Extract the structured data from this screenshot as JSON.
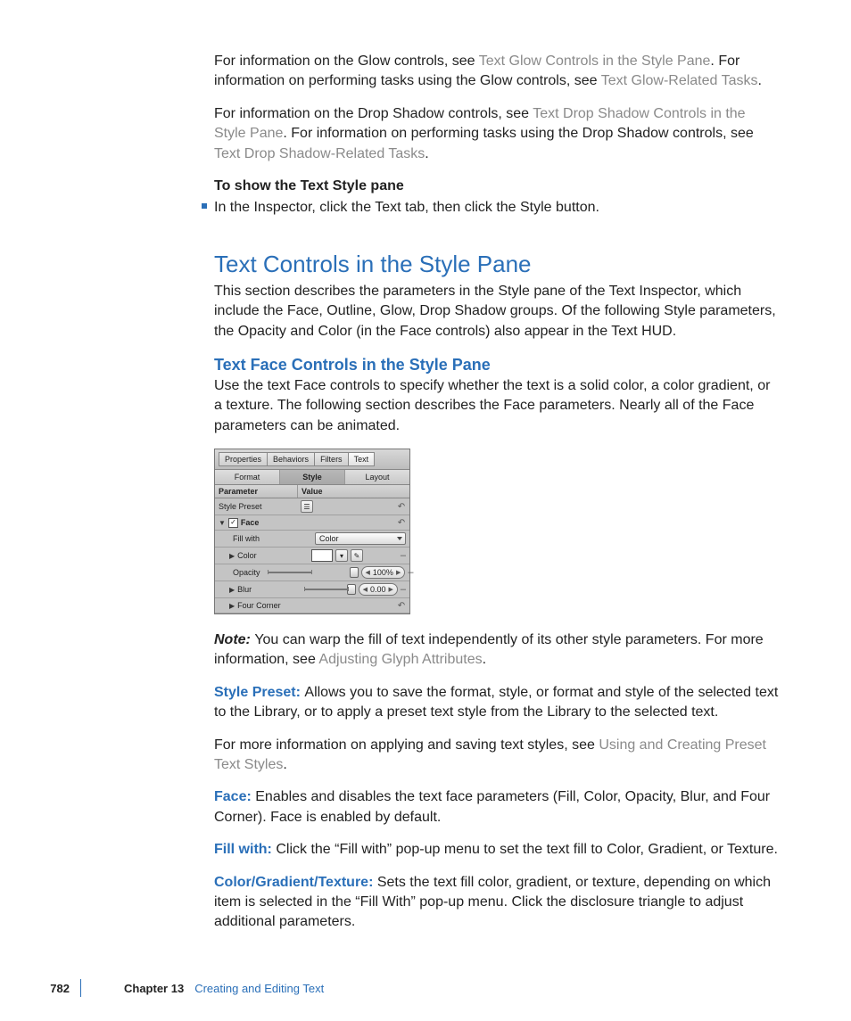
{
  "p1": {
    "t1": "For information on the Glow controls, see ",
    "l1": "Text Glow Controls in the Style Pane",
    "t2": ". For information on performing tasks using the Glow controls, see ",
    "l2": "Text Glow-Related Tasks",
    "t3": "."
  },
  "p2": {
    "t1": "For information on the Drop Shadow controls, see ",
    "l1": "Text Drop Shadow Controls in the Style Pane",
    "t2": ". For information on performing tasks using the Drop Shadow controls, see ",
    "l2": "Text Drop Shadow-Related Tasks",
    "t3": "."
  },
  "heading_show": "To show the Text Style pane",
  "bullet1": "In the Inspector, click the Text tab, then click the Style button.",
  "h1": "Text Controls in the Style Pane",
  "h1_body": "This section describes the parameters in the Style pane of the Text Inspector, which include the Face, Outline, Glow, Drop Shadow groups. Of the following Style parameters, the Opacity and Color (in the Face controls) also appear in the Text HUD.",
  "h2": "Text Face Controls in the Style Pane",
  "h2_body": "Use the text Face controls to specify whether the text is a solid color, a color gradient, or a texture. The following section describes the Face parameters. Nearly all of the Face parameters can be animated.",
  "panel": {
    "tabs1": {
      "a": "Properties",
      "b": "Behaviors",
      "c": "Filters",
      "d": "Text"
    },
    "tabs2": {
      "a": "Format",
      "b": "Style",
      "c": "Layout"
    },
    "hdr": {
      "a": "Parameter",
      "b": "Value"
    },
    "rows": {
      "style_preset": "Style Preset",
      "face": "Face",
      "fill_with": "Fill with",
      "fill_with_val": "Color",
      "color": "Color",
      "opacity": "Opacity",
      "opacity_val": "100%",
      "blur": "Blur",
      "blur_val": "0.00",
      "four_corner": "Four Corner"
    }
  },
  "note": {
    "label": "Note:  ",
    "t1": "You can warp the fill of text independently of its other style parameters. For more information, see ",
    "l1": "Adjusting Glyph Attributes",
    "t2": "."
  },
  "defs": {
    "style_preset": {
      "term": "Style Preset:  ",
      "body": "Allows you to save the format, style, or format and style of the selected text to the Library, or to apply a preset text style from the Library to the selected text."
    },
    "more": {
      "t1": "For more information on applying and saving text styles, see ",
      "l1": "Using and Creating Preset Text Styles",
      "t2": "."
    },
    "face": {
      "term": "Face:  ",
      "body": "Enables and disables the text face parameters (Fill, Color, Opacity, Blur, and Four Corner). Face is enabled by default."
    },
    "fill_with": {
      "term": "Fill with:  ",
      "body": "Click the “Fill with” pop-up menu to set the text fill to Color, Gradient, or Texture."
    },
    "cgt": {
      "term": "Color/Gradient/Texture:  ",
      "body": "Sets the text fill color, gradient, or texture, depending on which item is selected in the “Fill With” pop-up menu. Click the disclosure triangle to adjust additional parameters."
    }
  },
  "footer": {
    "page": "782",
    "chapter": "Chapter 13",
    "title": "Creating and Editing Text"
  }
}
